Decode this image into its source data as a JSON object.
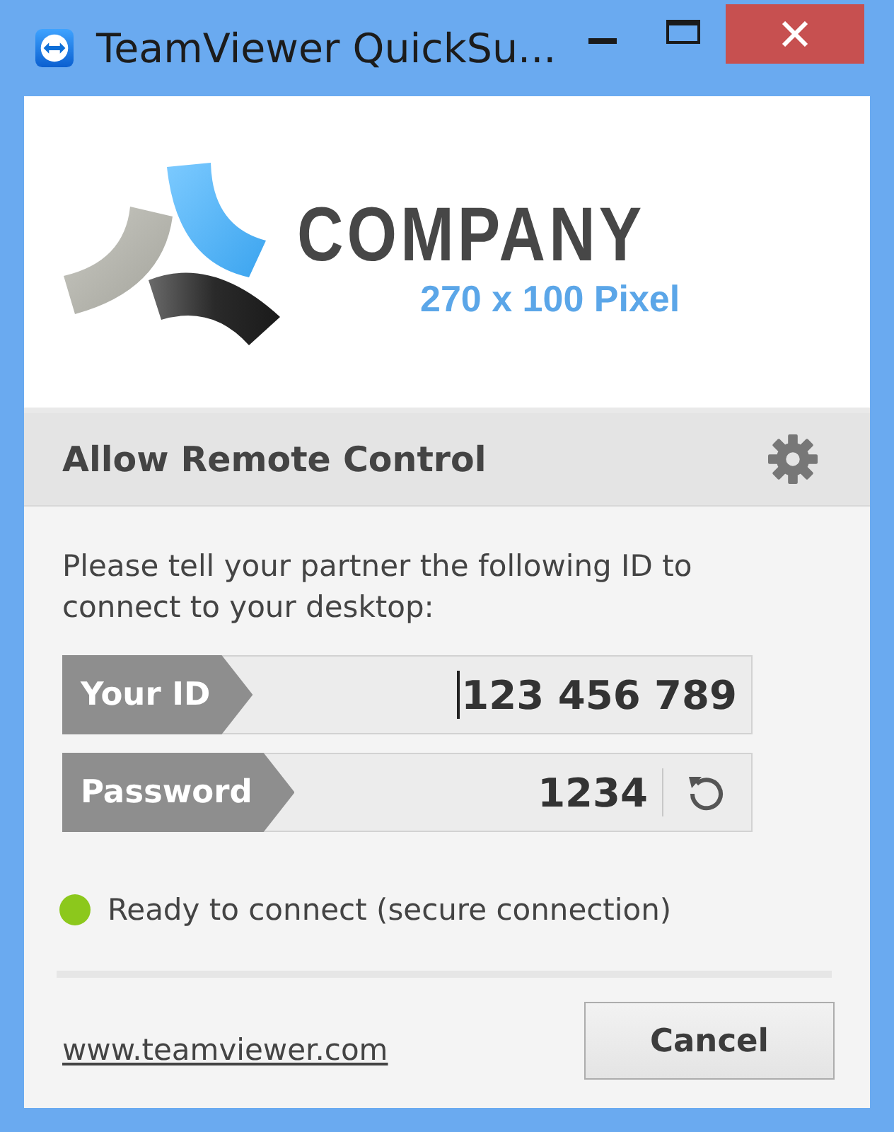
{
  "window": {
    "title": "TeamViewer QuickSu..."
  },
  "logo": {
    "name": "COMPANY",
    "caption": "270 x 100 Pixel"
  },
  "panel": {
    "title": "Allow Remote Control"
  },
  "instructions": "Please tell your partner the following ID to connect to your desktop:",
  "fields": [
    {
      "kind": "id",
      "label": "Your ID",
      "value": "123 456 789",
      "focused": true
    },
    {
      "kind": "password",
      "label": "Password",
      "value": "1234",
      "focused": false
    }
  ],
  "status": {
    "ready": true,
    "text": "Ready to connect (secure connection)"
  },
  "footer": {
    "link": "www.teamviewer.com",
    "button": "Cancel"
  }
}
